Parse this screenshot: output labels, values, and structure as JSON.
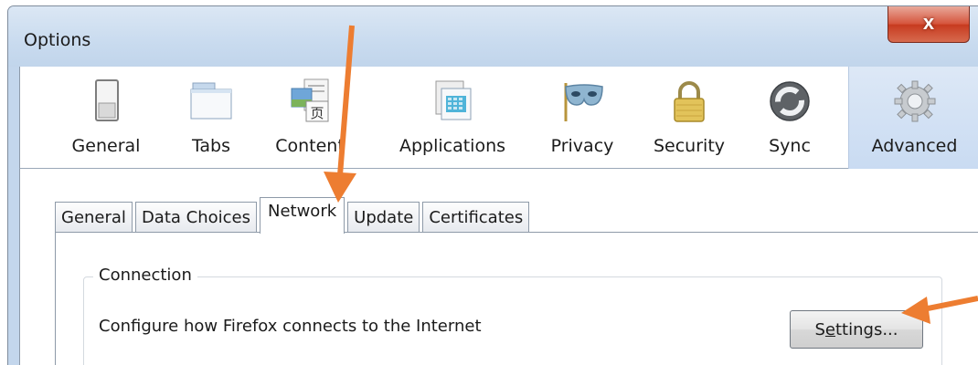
{
  "window": {
    "title": "Options",
    "close_glyph": "x"
  },
  "toolbar": {
    "items": [
      {
        "label": "General",
        "icon": "toggle-switch-icon"
      },
      {
        "label": "Tabs",
        "icon": "tabs-window-icon"
      },
      {
        "label": "Content",
        "icon": "content-document-icon"
      },
      {
        "label": "Applications",
        "icon": "applications-window-icon"
      },
      {
        "label": "Privacy",
        "icon": "mask-icon"
      },
      {
        "label": "Security",
        "icon": "padlock-icon"
      },
      {
        "label": "Sync",
        "icon": "sync-arrows-icon"
      },
      {
        "label": "Advanced",
        "icon": "gear-icon"
      }
    ],
    "selected": "Advanced"
  },
  "subtabs": {
    "items": [
      "General",
      "Data Choices",
      "Network",
      "Update",
      "Certificates"
    ],
    "active": "Network"
  },
  "connection": {
    "legend": "Connection",
    "description": "Configure how Firefox connects to the Internet",
    "button_label_pre": "S",
    "button_label_underlined": "e",
    "button_label_post": "ttings..."
  },
  "colors": {
    "annotation_arrow": "#ed7d31",
    "selected_toolbar_bg": "#c9dbf2",
    "titlebar": "#c9dbef"
  }
}
